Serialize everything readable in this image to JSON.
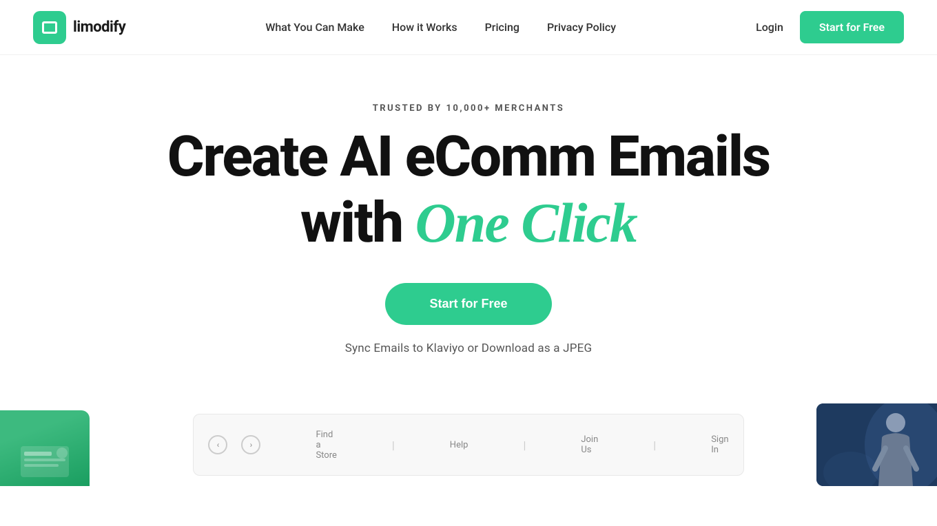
{
  "brand": {
    "logo_text": "limodify",
    "logo_icon_alt": "limodify logo icon"
  },
  "nav": {
    "links": [
      {
        "id": "what-you-can-make",
        "label": "What You Can Make"
      },
      {
        "id": "how-it-works",
        "label": "How it Works"
      },
      {
        "id": "pricing",
        "label": "Pricing"
      },
      {
        "id": "privacy-policy",
        "label": "Privacy Policy"
      }
    ],
    "login_label": "Login",
    "cta_label": "Start for Free"
  },
  "hero": {
    "trusted_badge": "TRUSTED BY 10,000+ MERCHANTS",
    "headline_line1": "Create AI eComm Emails",
    "headline_line2_prefix": "with ",
    "headline_line2_accent": "One Click",
    "cta_label": "Start for Free",
    "sub_text": "Sync Emails to Klaviyo or Download as a JPEG"
  },
  "preview": {
    "nav_items": [
      "Find a Store",
      "Help",
      "Join Us",
      "Sign In"
    ],
    "left_arrow": "‹",
    "right_arrow": "›"
  }
}
